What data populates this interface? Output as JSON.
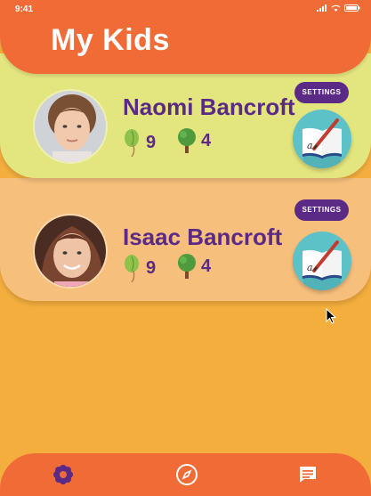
{
  "status_bar": {
    "time": "9:41"
  },
  "header": {
    "title": "My Kids"
  },
  "kids": [
    {
      "name": "Naomi Bancroft",
      "seeds": "9",
      "trees": "4",
      "settings_label": "SETTINGS"
    },
    {
      "name": "Isaac Bancroft",
      "seeds": "9",
      "trees": "4",
      "settings_label": "SETTINGS"
    }
  ],
  "bottom_nav": [
    {
      "icon": "flower-icon"
    },
    {
      "icon": "compass-icon"
    },
    {
      "icon": "chat-icon"
    }
  ],
  "colors": {
    "header": "#f06b36",
    "card_1": "#e3e57f",
    "card_2": "#f7bf7c",
    "background": "#f4ae3e",
    "accent": "#5b2a86"
  }
}
